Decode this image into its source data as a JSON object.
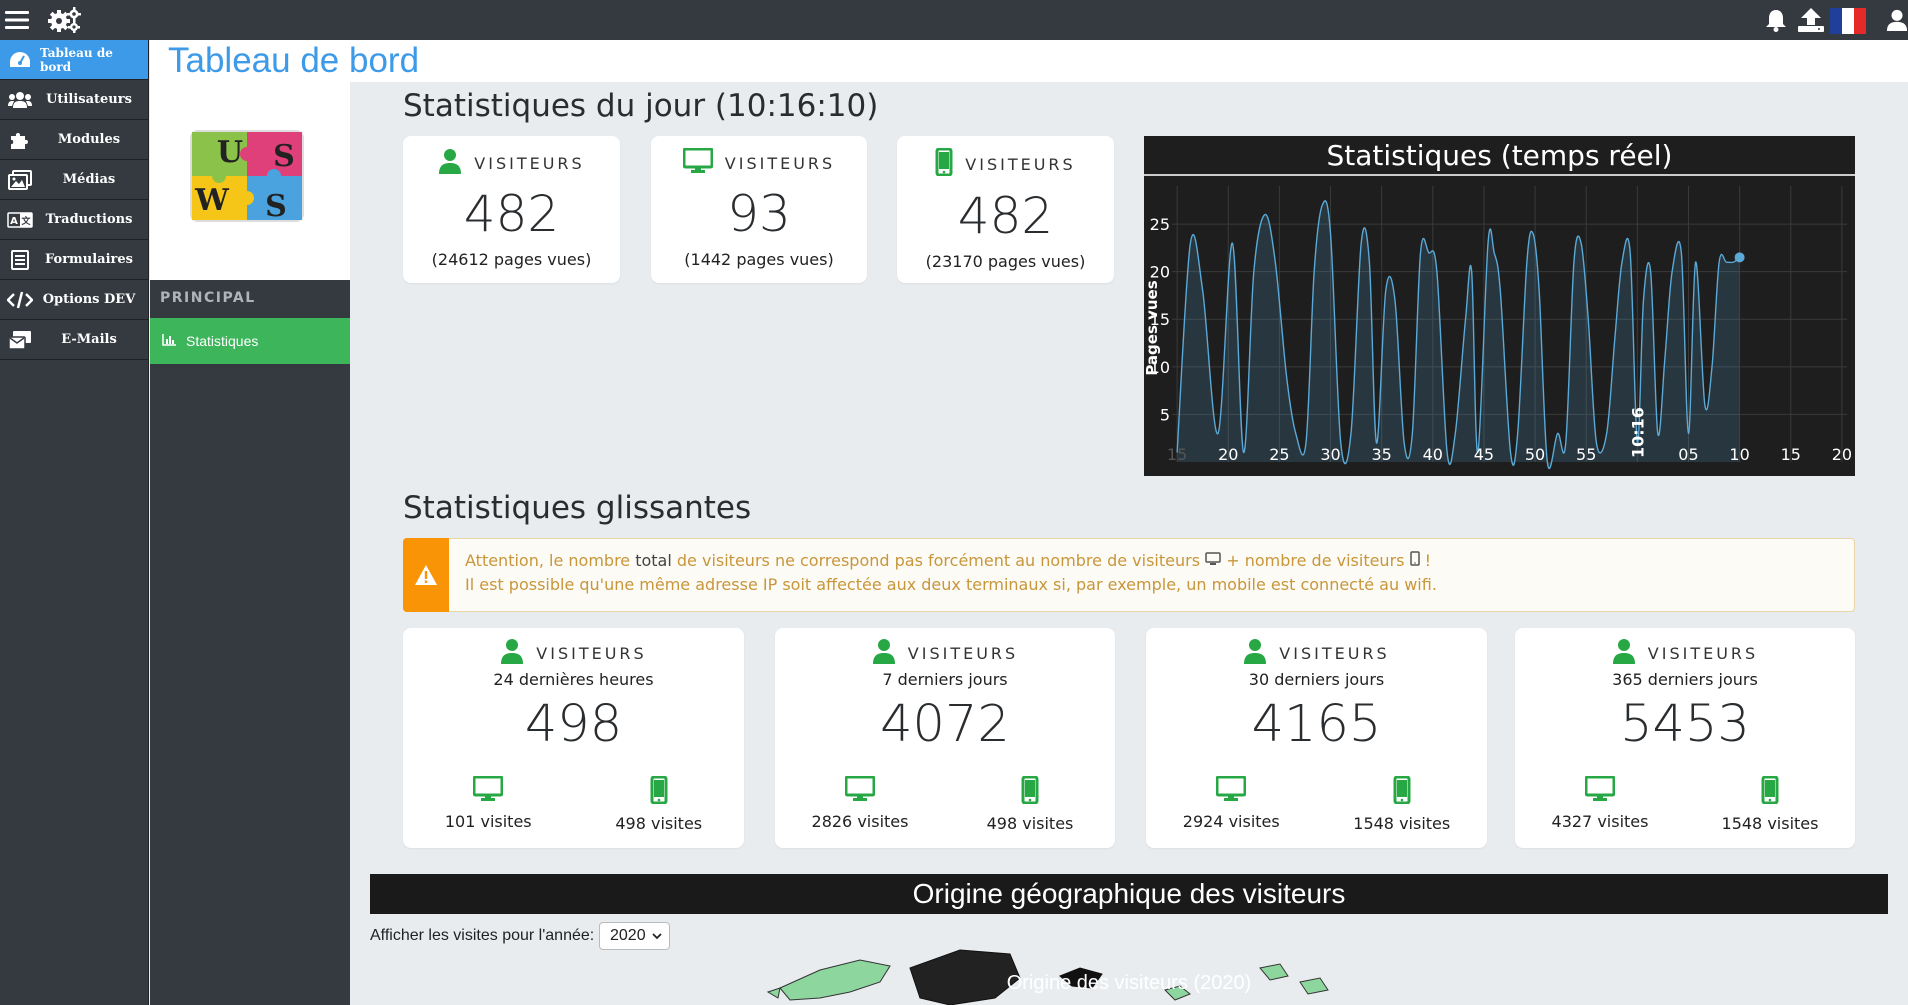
{
  "topbar": {
    "menu_icon": "hamburger-icon",
    "settings_icon": "gears-icon",
    "notifications_icon": "bell-icon",
    "upload_icon": "upload-icon",
    "language_flag": "french-flag",
    "user_icon": "user-icon"
  },
  "sidebar": {
    "items": [
      {
        "label": "Tableau de bord",
        "icon": "dashboard-icon",
        "active": true
      },
      {
        "label": "Utilisateurs",
        "icon": "users-icon"
      },
      {
        "label": "Modules",
        "icon": "puzzle-icon"
      },
      {
        "label": "Médias",
        "icon": "images-icon"
      },
      {
        "label": "Traductions",
        "icon": "language-icon"
      },
      {
        "label": "Formulaires",
        "icon": "form-icon"
      },
      {
        "label": "Options DEV",
        "icon": "code-icon"
      },
      {
        "label": "E-Mails",
        "icon": "mail-icon"
      }
    ]
  },
  "subpanel": {
    "section_title": "PRINCIPAL",
    "items": [
      {
        "label": "Statistiques",
        "icon": "bar-chart-icon",
        "active": true
      }
    ]
  },
  "page": {
    "title": "Tableau de bord"
  },
  "daily": {
    "heading": "Statistiques du jour (10:16:10)",
    "cards": [
      {
        "icon": "user-icon",
        "label": "VISITEURS",
        "value": "482",
        "sub": "(24612 pages vues)"
      },
      {
        "icon": "desktop-icon",
        "label": "VISITEURS",
        "value": "93",
        "sub": "(1442 pages vues)"
      },
      {
        "icon": "mobile-icon",
        "label": "VISITEURS",
        "value": "482",
        "sub": "(23170 pages vues)"
      }
    ]
  },
  "realtime": {
    "title": "Statistiques (temps réel)"
  },
  "chart_data": {
    "type": "area",
    "title": "Statistiques (temps réel)",
    "ylabel": "Pages vues",
    "xlabel": "",
    "y_ticks": [
      5,
      10,
      15,
      20,
      25
    ],
    "x_ticks": [
      "15",
      "20",
      "25",
      "30",
      "35",
      "40",
      "45",
      "50",
      "55",
      "10:16",
      "05",
      "10",
      "15",
      "20"
    ],
    "x_tick_positions": [
      15,
      20,
      25,
      30,
      35,
      40,
      45,
      50,
      55,
      60,
      65,
      70,
      75,
      80
    ],
    "ylim": [
      0,
      29
    ],
    "xlim": [
      14.5,
      80.5
    ],
    "grid": true,
    "color": "#5aa9d6",
    "x": [
      15,
      16.3,
      17.5,
      19,
      20.4,
      21.5,
      22.5,
      23.6,
      24.6,
      25.7,
      26.6,
      27.6,
      28.4,
      29.2,
      30,
      31,
      32,
      33,
      33.8,
      34.5,
      35.4,
      36.3,
      37.2,
      38,
      38.8,
      39.6,
      40.4,
      41.4,
      42.2,
      43.2,
      43.8,
      44.4,
      45.4,
      46,
      46.6,
      47.6,
      48.3,
      49.2,
      49.8,
      50.4,
      51.2,
      52.2,
      53,
      53.8,
      54.5,
      55.2,
      56,
      57,
      57.8,
      58.5,
      59.3,
      60,
      60.6,
      61.3,
      62,
      62.7,
      63.4,
      64.3,
      65,
      65.7,
      66.6,
      67.3,
      68,
      68.7,
      69.4,
      70
    ],
    "y": [
      1,
      23,
      18,
      3,
      23,
      1,
      20,
      26,
      21,
      9,
      3,
      2,
      20,
      27,
      24,
      2,
      3,
      23,
      21,
      2,
      18,
      17,
      2,
      3,
      22,
      22,
      20,
      1,
      3,
      15,
      20,
      1,
      23,
      22,
      18,
      1,
      3,
      21,
      24,
      18,
      0,
      3,
      2,
      21,
      23,
      15,
      2,
      3,
      13,
      21,
      22,
      2,
      17,
      20,
      3,
      11,
      20,
      22,
      3,
      21,
      6,
      10,
      21,
      21,
      21,
      21.5
    ]
  },
  "rolling": {
    "heading": "Statistiques glissantes",
    "alert": {
      "icon": "warning-icon",
      "line1_a": "Attention, le nombre ",
      "line1_b": "total",
      "line1_c": " de visiteurs ne correspond pas forcément au nombre de visiteurs ",
      "line1_d": " + nombre de visiteurs ",
      "line1_e": " !",
      "line2": "Il est possible qu'une même adresse IP soit affectée aux deux terminaux si, par exemple, un mobile est connecté au wifi."
    },
    "cards": [
      {
        "label": "VISITEURS",
        "period": "24 dernières heures",
        "value": "498",
        "desktop": "101 visites",
        "mobile": "498 visites"
      },
      {
        "label": "VISITEURS",
        "period": "7 derniers jours",
        "value": "4072",
        "desktop": "2826 visites",
        "mobile": "498 visites"
      },
      {
        "label": "VISITEURS",
        "period": "30 derniers jours",
        "value": "4165",
        "desktop": "2924 visites",
        "mobile": "1548 visites"
      },
      {
        "label": "VISITEURS",
        "period": "365 derniers jours",
        "value": "5453",
        "desktop": "4327 visites",
        "mobile": "1548 visites"
      }
    ]
  },
  "geo": {
    "heading": "Origine géographique des visiteurs",
    "year_label": "Afficher les visites pour l'année:",
    "year_value": "2020",
    "map_title": "Origine des visiteurs (2020)"
  },
  "colors": {
    "accent_blue": "#3c9ae8",
    "success_green": "#3cb55b",
    "icon_green": "#28a745",
    "warning_orange": "#f89406",
    "sidebar_bg": "#343a40"
  }
}
